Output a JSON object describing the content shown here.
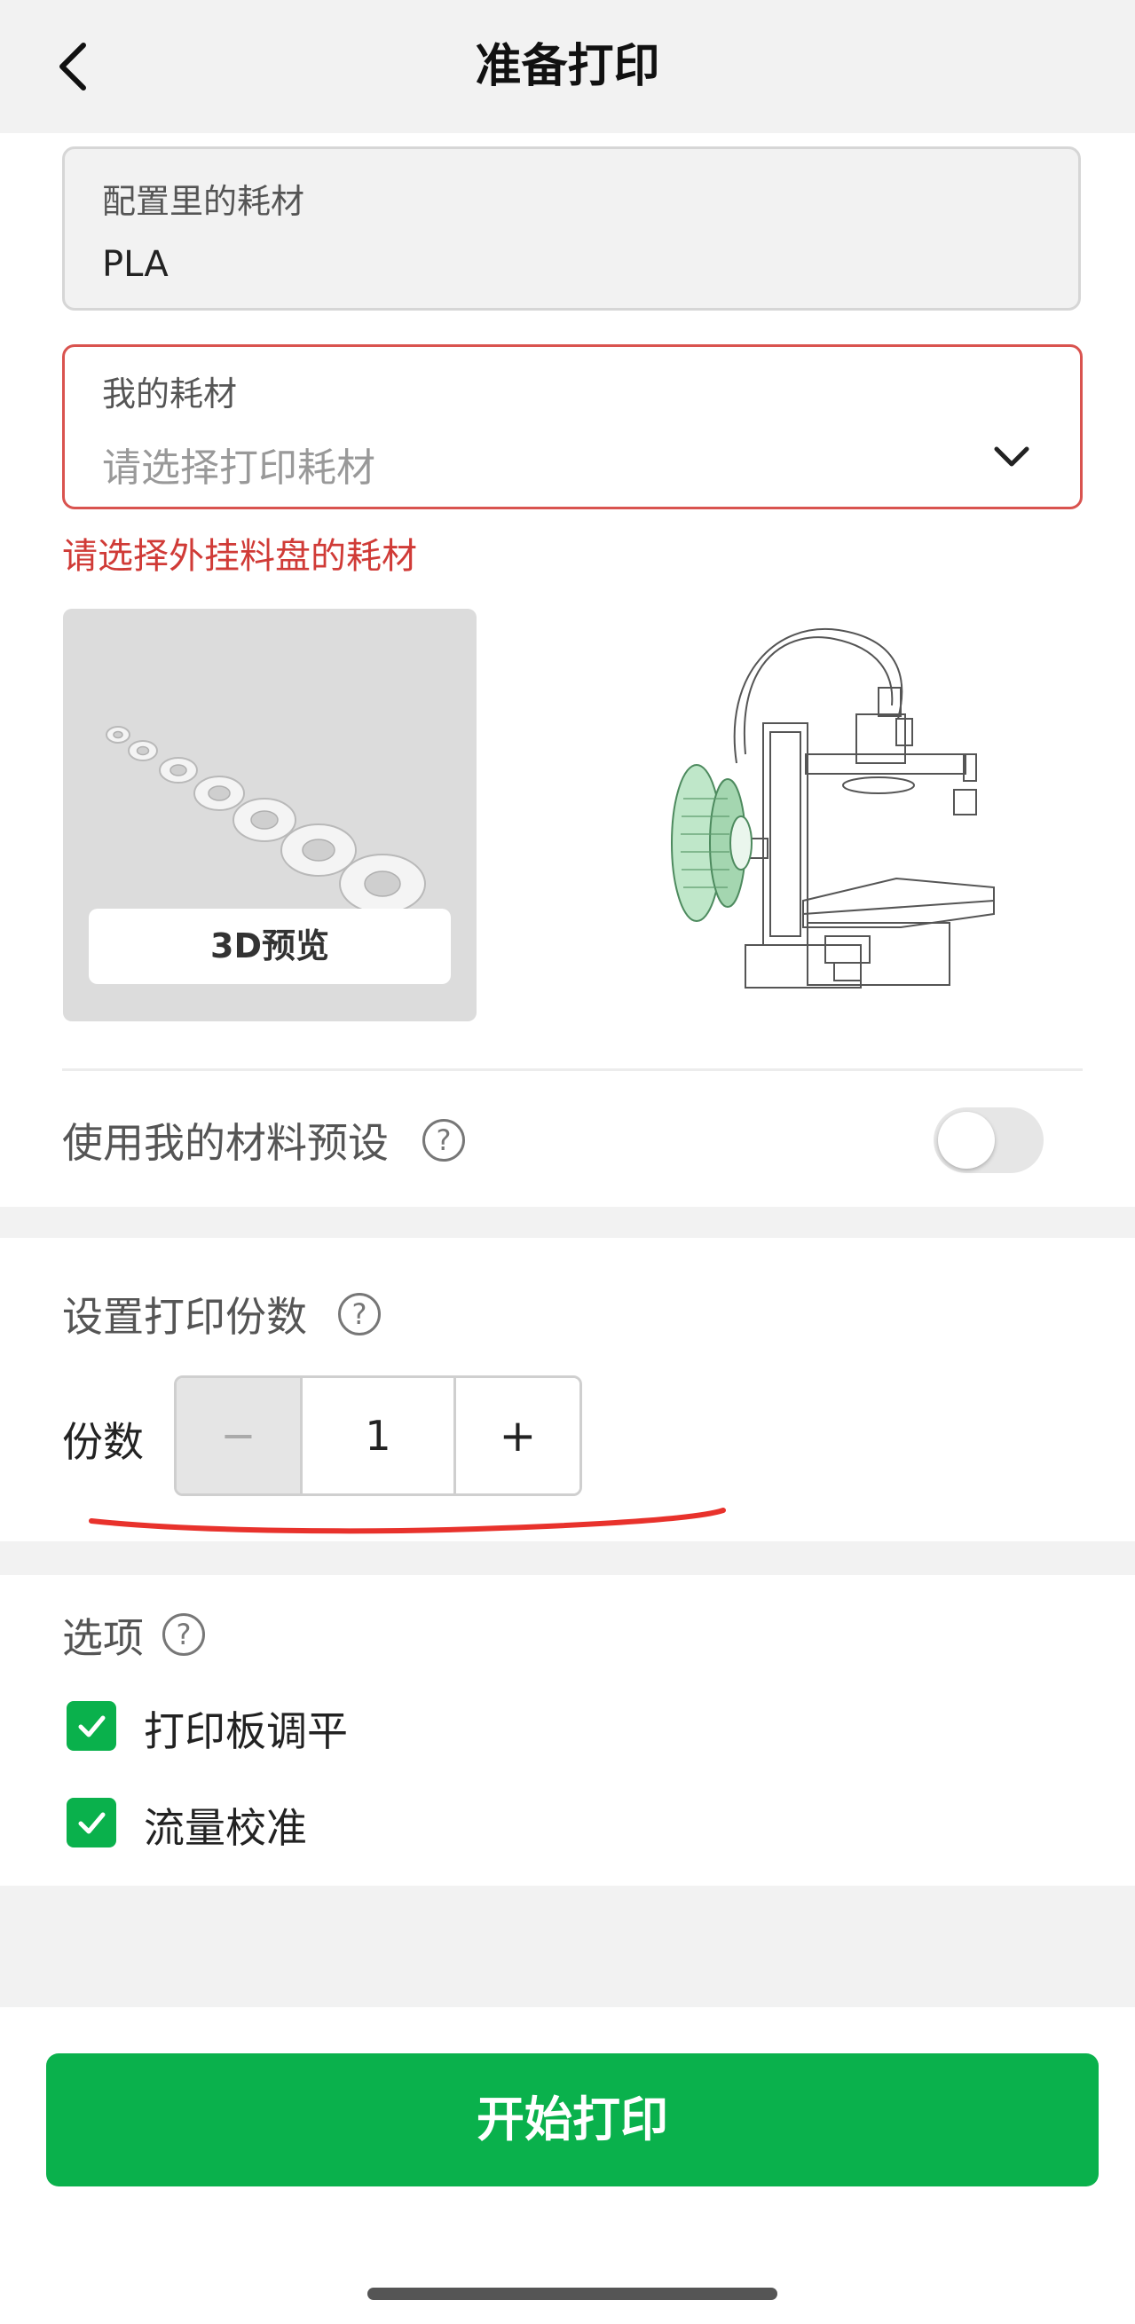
{
  "header": {
    "title": "准备打印",
    "back_icon": "chevron-left-icon"
  },
  "profile_filament": {
    "label": "配置里的耗材",
    "value": "PLA"
  },
  "my_filament": {
    "label": "我的耗材",
    "placeholder": "请选择打印耗材",
    "error": "请选择外挂料盘的耗材",
    "dropdown_icon": "chevron-down-icon"
  },
  "preview": {
    "button_label": "3D预览"
  },
  "material_preset": {
    "label": "使用我的材料预设",
    "help": "?",
    "enabled": false
  },
  "copies": {
    "section_title": "设置打印份数",
    "help": "?",
    "label": "份数",
    "minus": "−",
    "value": "1",
    "plus": "+"
  },
  "options": {
    "section_title": "选项",
    "help": "?",
    "items": [
      {
        "label": "打印板调平",
        "checked": true
      },
      {
        "label": "流量校准",
        "checked": true
      }
    ]
  },
  "footer": {
    "start_label": "开始打印"
  },
  "colors": {
    "accent_green": "#0ab14c",
    "error_red": "#d03b37",
    "annotation_red": "#e8322c"
  }
}
